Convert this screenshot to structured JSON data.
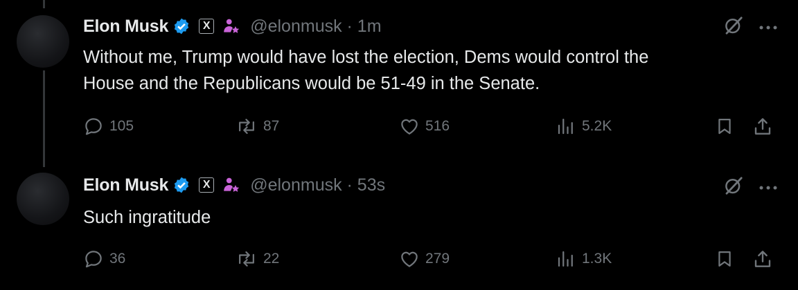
{
  "tweets": [
    {
      "author_name": "Elon Musk",
      "handle_line": "@elonmusk · 1m",
      "text_lines": [
        "Without me, Trump would have lost the election, Dems would control the",
        "House and the Republicans would be 51-49 in the Senate."
      ],
      "replies": "105",
      "reposts": "87",
      "likes": "516",
      "views": "5.2K"
    },
    {
      "author_name": "Elon Musk",
      "handle_line": "@elonmusk · 53s",
      "text_lines": [
        "Such ingratitude"
      ],
      "replies": "36",
      "reposts": "22",
      "likes": "279",
      "views": "1.3K"
    }
  ],
  "badge_x_label": "X",
  "colors": {
    "background": "#000000",
    "text": "#e7e9ea",
    "muted": "#71767b",
    "verified": "#1d9bf0",
    "affiliate": "#c964d8"
  },
  "icons": [
    "verified-badge-icon",
    "x-badge-icon",
    "affiliate-icon",
    "grok-icon",
    "more-icon",
    "reply-icon",
    "repost-icon",
    "like-icon",
    "views-icon",
    "bookmark-icon",
    "share-icon"
  ]
}
